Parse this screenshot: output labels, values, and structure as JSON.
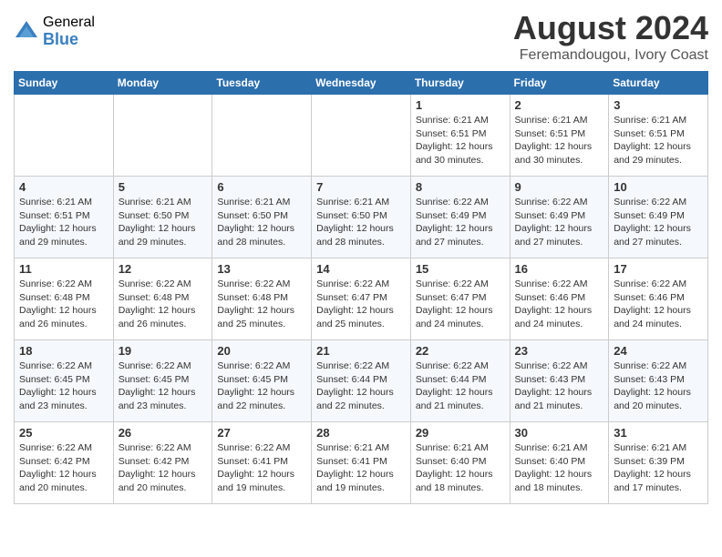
{
  "logo": {
    "general": "General",
    "blue": "Blue"
  },
  "title": {
    "month_year": "August 2024",
    "location": "Feremandougou, Ivory Coast"
  },
  "headers": [
    "Sunday",
    "Monday",
    "Tuesday",
    "Wednesday",
    "Thursday",
    "Friday",
    "Saturday"
  ],
  "weeks": [
    [
      {
        "day": "",
        "info": ""
      },
      {
        "day": "",
        "info": ""
      },
      {
        "day": "",
        "info": ""
      },
      {
        "day": "",
        "info": ""
      },
      {
        "day": "1",
        "info": "Sunrise: 6:21 AM\nSunset: 6:51 PM\nDaylight: 12 hours\nand 30 minutes."
      },
      {
        "day": "2",
        "info": "Sunrise: 6:21 AM\nSunset: 6:51 PM\nDaylight: 12 hours\nand 30 minutes."
      },
      {
        "day": "3",
        "info": "Sunrise: 6:21 AM\nSunset: 6:51 PM\nDaylight: 12 hours\nand 29 minutes."
      }
    ],
    [
      {
        "day": "4",
        "info": "Sunrise: 6:21 AM\nSunset: 6:51 PM\nDaylight: 12 hours\nand 29 minutes."
      },
      {
        "day": "5",
        "info": "Sunrise: 6:21 AM\nSunset: 6:50 PM\nDaylight: 12 hours\nand 29 minutes."
      },
      {
        "day": "6",
        "info": "Sunrise: 6:21 AM\nSunset: 6:50 PM\nDaylight: 12 hours\nand 28 minutes."
      },
      {
        "day": "7",
        "info": "Sunrise: 6:21 AM\nSunset: 6:50 PM\nDaylight: 12 hours\nand 28 minutes."
      },
      {
        "day": "8",
        "info": "Sunrise: 6:22 AM\nSunset: 6:49 PM\nDaylight: 12 hours\nand 27 minutes."
      },
      {
        "day": "9",
        "info": "Sunrise: 6:22 AM\nSunset: 6:49 PM\nDaylight: 12 hours\nand 27 minutes."
      },
      {
        "day": "10",
        "info": "Sunrise: 6:22 AM\nSunset: 6:49 PM\nDaylight: 12 hours\nand 27 minutes."
      }
    ],
    [
      {
        "day": "11",
        "info": "Sunrise: 6:22 AM\nSunset: 6:48 PM\nDaylight: 12 hours\nand 26 minutes."
      },
      {
        "day": "12",
        "info": "Sunrise: 6:22 AM\nSunset: 6:48 PM\nDaylight: 12 hours\nand 26 minutes."
      },
      {
        "day": "13",
        "info": "Sunrise: 6:22 AM\nSunset: 6:48 PM\nDaylight: 12 hours\nand 25 minutes."
      },
      {
        "day": "14",
        "info": "Sunrise: 6:22 AM\nSunset: 6:47 PM\nDaylight: 12 hours\nand 25 minutes."
      },
      {
        "day": "15",
        "info": "Sunrise: 6:22 AM\nSunset: 6:47 PM\nDaylight: 12 hours\nand 24 minutes."
      },
      {
        "day": "16",
        "info": "Sunrise: 6:22 AM\nSunset: 6:46 PM\nDaylight: 12 hours\nand 24 minutes."
      },
      {
        "day": "17",
        "info": "Sunrise: 6:22 AM\nSunset: 6:46 PM\nDaylight: 12 hours\nand 24 minutes."
      }
    ],
    [
      {
        "day": "18",
        "info": "Sunrise: 6:22 AM\nSunset: 6:45 PM\nDaylight: 12 hours\nand 23 minutes."
      },
      {
        "day": "19",
        "info": "Sunrise: 6:22 AM\nSunset: 6:45 PM\nDaylight: 12 hours\nand 23 minutes."
      },
      {
        "day": "20",
        "info": "Sunrise: 6:22 AM\nSunset: 6:45 PM\nDaylight: 12 hours\nand 22 minutes."
      },
      {
        "day": "21",
        "info": "Sunrise: 6:22 AM\nSunset: 6:44 PM\nDaylight: 12 hours\nand 22 minutes."
      },
      {
        "day": "22",
        "info": "Sunrise: 6:22 AM\nSunset: 6:44 PM\nDaylight: 12 hours\nand 21 minutes."
      },
      {
        "day": "23",
        "info": "Sunrise: 6:22 AM\nSunset: 6:43 PM\nDaylight: 12 hours\nand 21 minutes."
      },
      {
        "day": "24",
        "info": "Sunrise: 6:22 AM\nSunset: 6:43 PM\nDaylight: 12 hours\nand 20 minutes."
      }
    ],
    [
      {
        "day": "25",
        "info": "Sunrise: 6:22 AM\nSunset: 6:42 PM\nDaylight: 12 hours\nand 20 minutes."
      },
      {
        "day": "26",
        "info": "Sunrise: 6:22 AM\nSunset: 6:42 PM\nDaylight: 12 hours\nand 20 minutes."
      },
      {
        "day": "27",
        "info": "Sunrise: 6:22 AM\nSunset: 6:41 PM\nDaylight: 12 hours\nand 19 minutes."
      },
      {
        "day": "28",
        "info": "Sunrise: 6:21 AM\nSunset: 6:41 PM\nDaylight: 12 hours\nand 19 minutes."
      },
      {
        "day": "29",
        "info": "Sunrise: 6:21 AM\nSunset: 6:40 PM\nDaylight: 12 hours\nand 18 minutes."
      },
      {
        "day": "30",
        "info": "Sunrise: 6:21 AM\nSunset: 6:40 PM\nDaylight: 12 hours\nand 18 minutes."
      },
      {
        "day": "31",
        "info": "Sunrise: 6:21 AM\nSunset: 6:39 PM\nDaylight: 12 hours\nand 17 minutes."
      }
    ]
  ]
}
